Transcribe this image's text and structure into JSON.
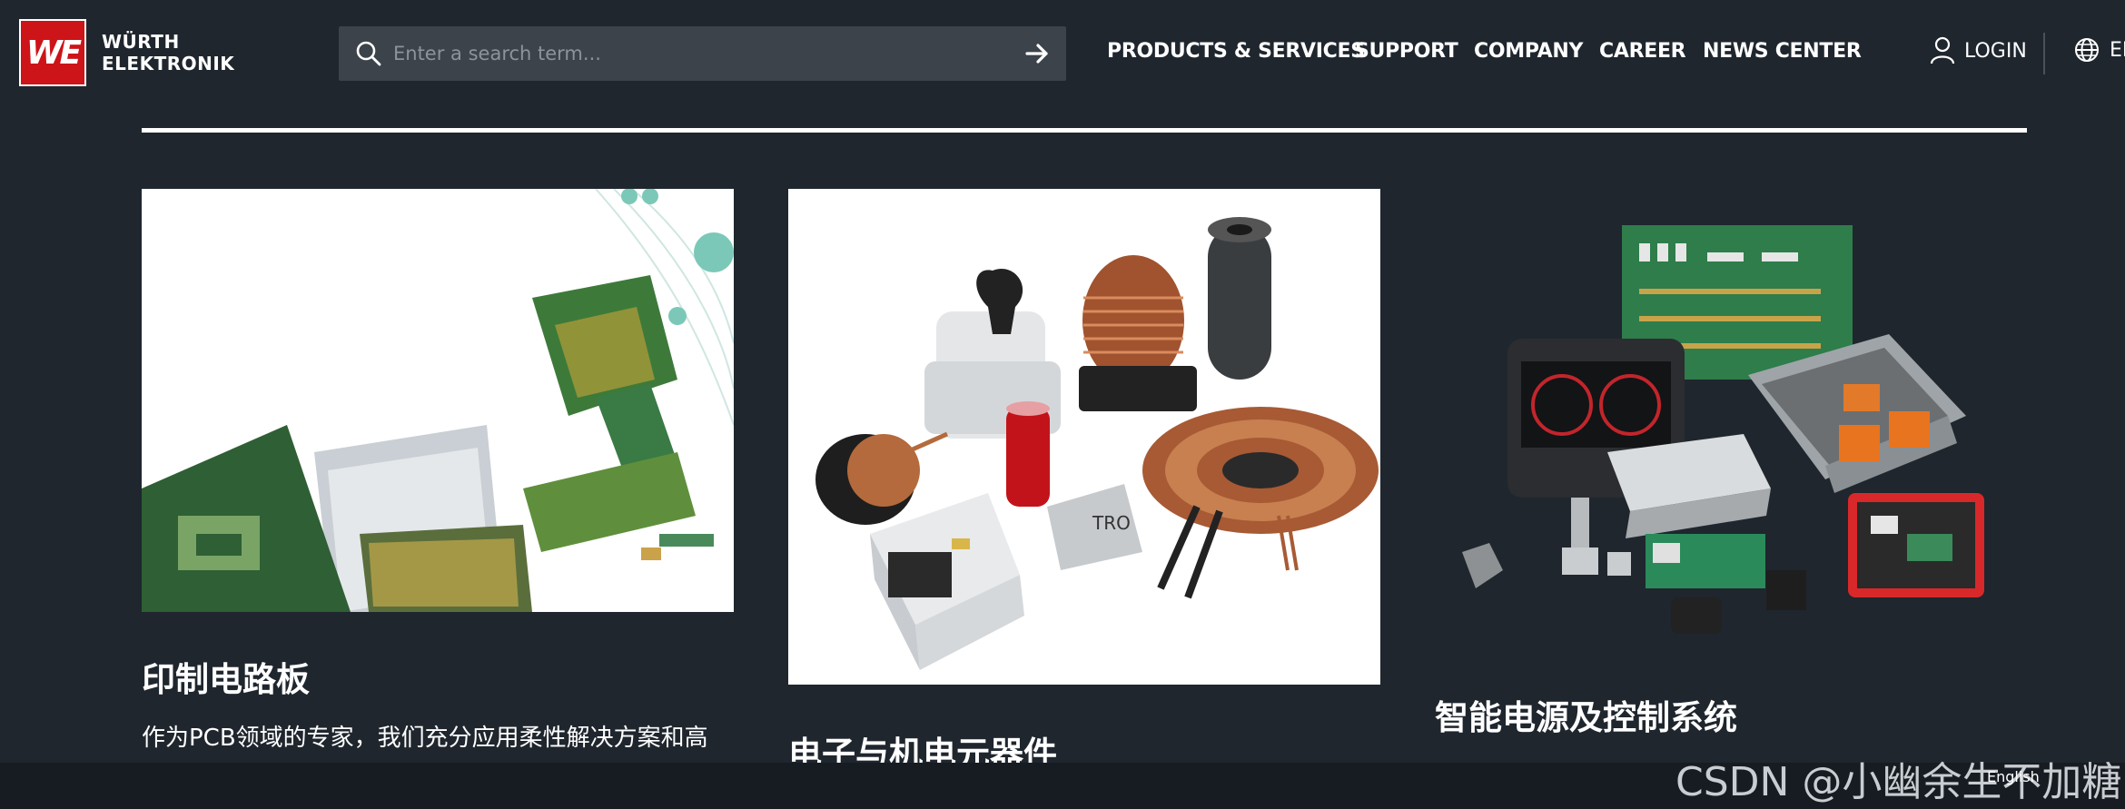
{
  "header": {
    "logo_text": "WE",
    "brand_line1": "WÜRTH",
    "brand_line2": "ELEKTRONIK",
    "search_placeholder": "Enter a search term...",
    "nav": [
      {
        "label": "PRODUCTS & SERVICES"
      },
      {
        "label": "SUPPORT"
      },
      {
        "label": "COMPANY"
      },
      {
        "label": "CAREER"
      },
      {
        "label": "NEWS CENTER"
      }
    ],
    "login_label": "LOGIN",
    "language_label": "EN"
  },
  "cards": [
    {
      "title": "印制电路板",
      "description": "作为PCB领域的专家，我们充分应用柔性解决方案和高"
    },
    {
      "title": "电子与机电元器件"
    },
    {
      "title": "智能电源及控制系统"
    }
  ],
  "watermark": "CSDN @小幽余生不加糖",
  "watermark_logo": "English",
  "colors": {
    "background": "#1f262e",
    "brand_red": "#cc1419",
    "search_bg": "#3c434b",
    "text": "#ffffff"
  }
}
